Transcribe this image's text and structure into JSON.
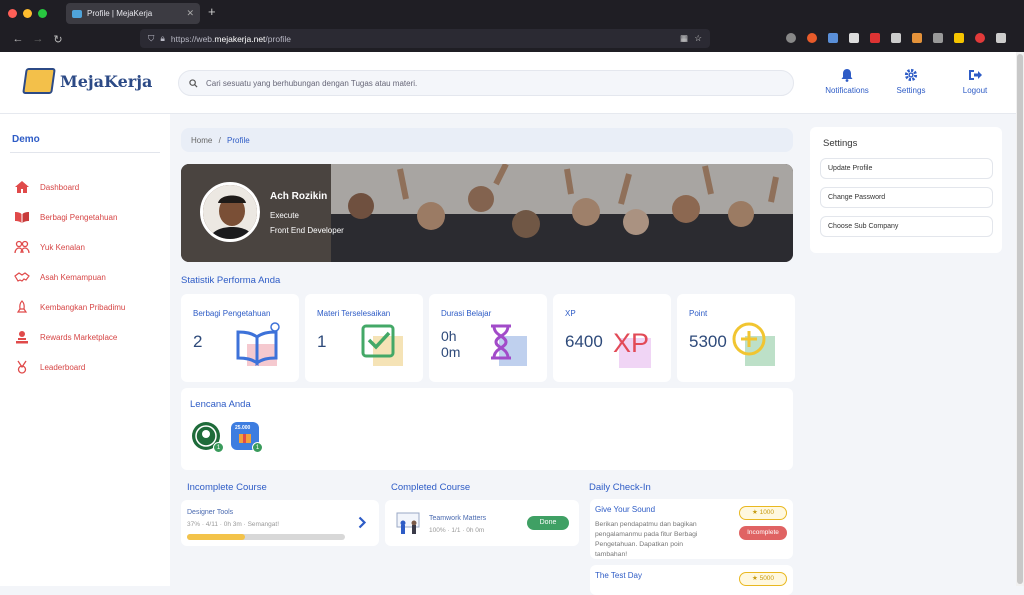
{
  "browser": {
    "tab_title": "Profile | MejaKerja",
    "url_prefix": "https://web.",
    "url_domain": "mejakerja.net",
    "url_path": "/profile",
    "colors": {
      "close": "#ff5f57",
      "minimize": "#febc2e",
      "maximize": "#28c840"
    }
  },
  "header": {
    "logo_text": "MejaKerja",
    "search_placeholder": "Cari sesuatu yang berhubungan dengan Tugas atau materi.",
    "notifications_label": "Notifications",
    "settings_label": "Settings",
    "logout_label": "Logout"
  },
  "sidebar": {
    "title": "Demo",
    "items": [
      {
        "label": "Dashboard",
        "icon": "home-icon"
      },
      {
        "label": "Berbagi Pengetahuan",
        "icon": "book-icon"
      },
      {
        "label": "Yuk Kenalan",
        "icon": "people-icon"
      },
      {
        "label": "Asah Kemampuan",
        "icon": "handshake-icon"
      },
      {
        "label": "Kembangkan Pribadimu",
        "icon": "rocket-icon"
      },
      {
        "label": "Rewards Marketplace",
        "icon": "trophy-icon"
      },
      {
        "label": "Leaderboard",
        "icon": "medal-icon"
      }
    ]
  },
  "breadcrumb": {
    "home": "Home",
    "separator": "/",
    "current": "Profile"
  },
  "profile": {
    "name": "Ach Rozikin",
    "role": "Execute",
    "position": "Front End Developer"
  },
  "stats": {
    "title": "Statistik Performa Anda",
    "cards": [
      {
        "label": "Berbagi Pengetahuan",
        "value": "2"
      },
      {
        "label": "Materi Terselesaikan",
        "value": "1"
      },
      {
        "label": "Durasi Belajar",
        "value_line1": "0h",
        "value_line2": "0m"
      },
      {
        "label": "XP",
        "value": "6400",
        "art_text": "XP"
      },
      {
        "label": "Point",
        "value": "5300"
      }
    ]
  },
  "badges": {
    "title": "Lencana Anda",
    "items": [
      {
        "count": "1",
        "icon": "coffee-badge-icon"
      },
      {
        "count": "1",
        "icon": "voucher-badge-icon",
        "text": "25.000"
      }
    ]
  },
  "incomplete": {
    "title": "Incomplete Course",
    "course_name": "Designer Tools",
    "meta": "37% · 4/11 · 0h 3m · Semangat!",
    "progress": 0.37
  },
  "completed": {
    "title": "Completed Course",
    "course_name": "Teamwork Matters",
    "meta": "100% · 1/1 · 0h 0m",
    "status": "Done"
  },
  "checkin": {
    "title": "Daily Check-In",
    "items": [
      {
        "title": "Give Your Sound",
        "desc": "Berikan pendapatmu dan bagikan pengalamanmu pada fitur Berbagi Pengetahuan. Dapatkan poin tambahan!",
        "points": "1000",
        "status": "Incomplete"
      },
      {
        "title": "The Test Day",
        "points": "5000"
      }
    ]
  },
  "settings_panel": {
    "title": "Settings",
    "buttons": [
      "Update Profile",
      "Change Password",
      "Choose Sub Company"
    ]
  }
}
